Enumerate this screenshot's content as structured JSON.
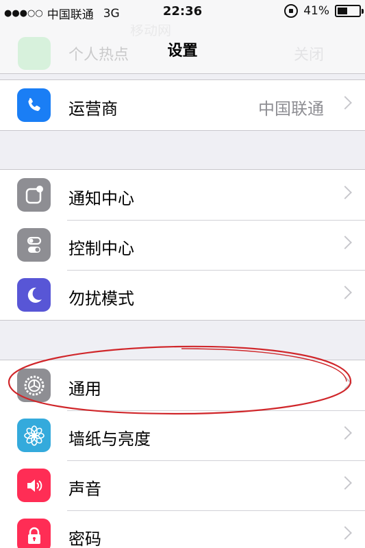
{
  "status_bar": {
    "signal": "●●●○○",
    "carrier": "中国联通",
    "network": "3G",
    "time": "22:36",
    "battery": "41%"
  },
  "nav": {
    "title": "设置",
    "ghost_label": "个人热点",
    "ghost_value": "关闭",
    "ghost_top": "移动网"
  },
  "groups": {
    "carrier": [
      {
        "label": "运营商",
        "value": "中国联通",
        "icon": "phone-icon",
        "color": "#1a7ef5"
      }
    ],
    "system": [
      {
        "label": "通知中心",
        "icon": "notification-center-icon",
        "color": "#8e8e93"
      },
      {
        "label": "控制中心",
        "icon": "control-center-icon",
        "color": "#8e8e93"
      },
      {
        "label": "勿扰模式",
        "icon": "moon-icon",
        "color": "#5856d6"
      }
    ],
    "general": [
      {
        "label": "通用",
        "icon": "gear-icon",
        "color": "#8e8e93"
      },
      {
        "label": "墙纸与亮度",
        "icon": "flower-icon",
        "color": "#34aadc"
      },
      {
        "label": "声音",
        "icon": "speaker-icon",
        "color": "#ff2d55"
      },
      {
        "label": "密码",
        "icon": "lock-icon",
        "color": "#ff2d55"
      }
    ]
  },
  "annotation_color": "#d0262a"
}
